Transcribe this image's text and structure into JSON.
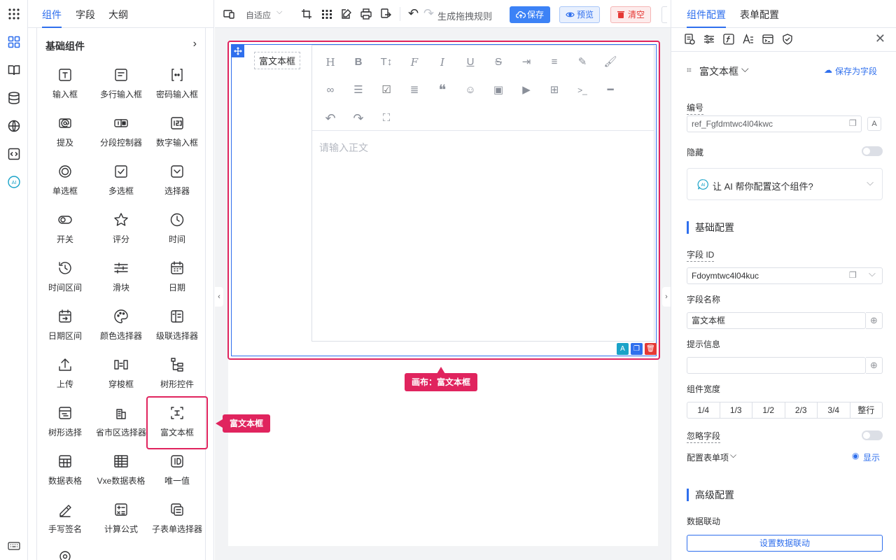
{
  "left_tabs": [
    "组件",
    "字段",
    "大纲"
  ],
  "left_section": "基础组件",
  "components": [
    {
      "label": "输入框",
      "icon": "text-input-icon"
    },
    {
      "label": "多行输入框",
      "icon": "textarea-icon"
    },
    {
      "label": "密码输入框",
      "icon": "password-input-icon"
    },
    {
      "label": "提及",
      "icon": "mention-icon"
    },
    {
      "label": "分段控制器",
      "icon": "segmented-icon"
    },
    {
      "label": "数字输入框",
      "icon": "number-input-icon"
    },
    {
      "label": "单选框",
      "icon": "radio-icon"
    },
    {
      "label": "多选框",
      "icon": "checkbox-icon"
    },
    {
      "label": "选择器",
      "icon": "select-icon"
    },
    {
      "label": "开关",
      "icon": "switch-icon"
    },
    {
      "label": "评分",
      "icon": "star-icon"
    },
    {
      "label": "时间",
      "icon": "clock-icon"
    },
    {
      "label": "时间区间",
      "icon": "time-range-icon"
    },
    {
      "label": "滑块",
      "icon": "slider-icon"
    },
    {
      "label": "日期",
      "icon": "calendar-icon"
    },
    {
      "label": "日期区间",
      "icon": "date-range-icon"
    },
    {
      "label": "颜色选择器",
      "icon": "palette-icon"
    },
    {
      "label": "级联选择器",
      "icon": "cascader-icon"
    },
    {
      "label": "上传",
      "icon": "upload-icon"
    },
    {
      "label": "穿梭框",
      "icon": "transfer-icon"
    },
    {
      "label": "树形控件",
      "icon": "tree-icon"
    },
    {
      "label": "树形选择",
      "icon": "tree-select-icon"
    },
    {
      "label": "省市区选择器",
      "icon": "region-icon"
    },
    {
      "label": "富文本框",
      "icon": "rich-text-icon"
    },
    {
      "label": "数据表格",
      "icon": "table-icon"
    },
    {
      "label": "Vxe数据表格",
      "icon": "vxe-table-icon"
    },
    {
      "label": "唯一值",
      "icon": "id-icon"
    },
    {
      "label": "手写签名",
      "icon": "signature-icon"
    },
    {
      "label": "计算公式",
      "icon": "calculator-icon"
    },
    {
      "label": "子表单选择器",
      "icon": "subform-icon"
    }
  ],
  "callout_component": "富文本框",
  "callout_canvas": "画布：富文本框",
  "toolbar": {
    "adaptive": "自适应",
    "generate_rule": "生成拖拽规则",
    "save": "保存",
    "preview": "预览",
    "clear": "清空"
  },
  "canvas_field_label": "富文本框",
  "editor_placeholder": "请输入正文",
  "right_tabs": [
    "组件配置",
    "表单配置"
  ],
  "component_name": "富文本框",
  "save_as_field": "保存为字段",
  "config": {
    "ref_label": "编号",
    "ref_value": "ref_Fgfdmtwc4l04kwc",
    "hidden_label": "隐藏",
    "ai_prompt": "让 AI 帮你配置这个组件?",
    "basic_section": "基础配置",
    "field_id_label": "字段 ID",
    "field_id_value": "Fdoymtwc4l04kuc",
    "field_name_label": "字段名称",
    "field_name_value": "富文本框",
    "hint_label": "提示信息",
    "hint_value": "",
    "width_label": "组件宽度",
    "width_options": [
      "1/4",
      "1/3",
      "1/2",
      "2/3",
      "3/4",
      "整行"
    ],
    "ignore_label": "忽略字段",
    "form_items_label": "配置表单项",
    "show_label": "显示",
    "advanced_section": "高级配置",
    "linkage_label": "数据联动",
    "linkage_button": "设置数据联动"
  }
}
